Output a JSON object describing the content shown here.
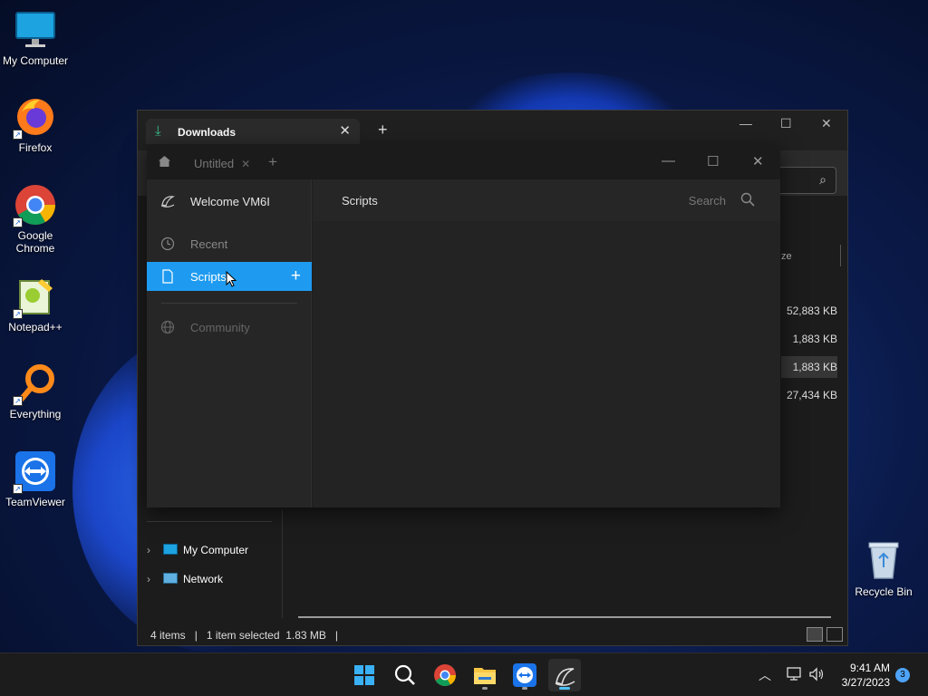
{
  "desktop": {
    "icons": [
      {
        "label": "My Computer",
        "icon": "monitor-icon"
      },
      {
        "label": "Firefox",
        "icon": "firefox-icon"
      },
      {
        "label": "Google Chrome",
        "icon": "chrome-icon"
      },
      {
        "label": "Notepad++",
        "icon": "notepadpp-icon"
      },
      {
        "label": "Everything",
        "icon": "everything-icon"
      },
      {
        "label": "TeamViewer",
        "icon": "teamviewer-icon"
      }
    ],
    "recycle_bin": "Recycle Bin"
  },
  "explorer": {
    "tab_title": "Downloads",
    "column_size": "ze",
    "sizes": [
      "52,883 KB",
      "1,883 KB",
      "1,883 KB",
      "27,434 KB"
    ],
    "selected_index": 2,
    "nav": [
      {
        "label": "My Computer",
        "icon": "monitor-icon"
      },
      {
        "label": "Network",
        "icon": "network-icon"
      }
    ],
    "status": {
      "items": "4 items",
      "selected": "1 item selected  1.83 MB"
    }
  },
  "app": {
    "tab_title": "Untitled",
    "sidebar": {
      "welcome": "Welcome VM6I",
      "recent": "Recent",
      "scripts": "Scripts",
      "community": "Community"
    },
    "main": {
      "title": "Scripts",
      "search_placeholder": "Search"
    }
  },
  "taskbar": {
    "apps": [
      "start-icon",
      "search-icon",
      "chrome-icon",
      "file-explorer-icon",
      "teamviewer-icon",
      "app-icon"
    ],
    "time": "9:41 AM",
    "date": "3/27/2023",
    "notifications": "3"
  },
  "colors": {
    "accent": "#1e9bf0",
    "download_green": "#3cc08a"
  }
}
